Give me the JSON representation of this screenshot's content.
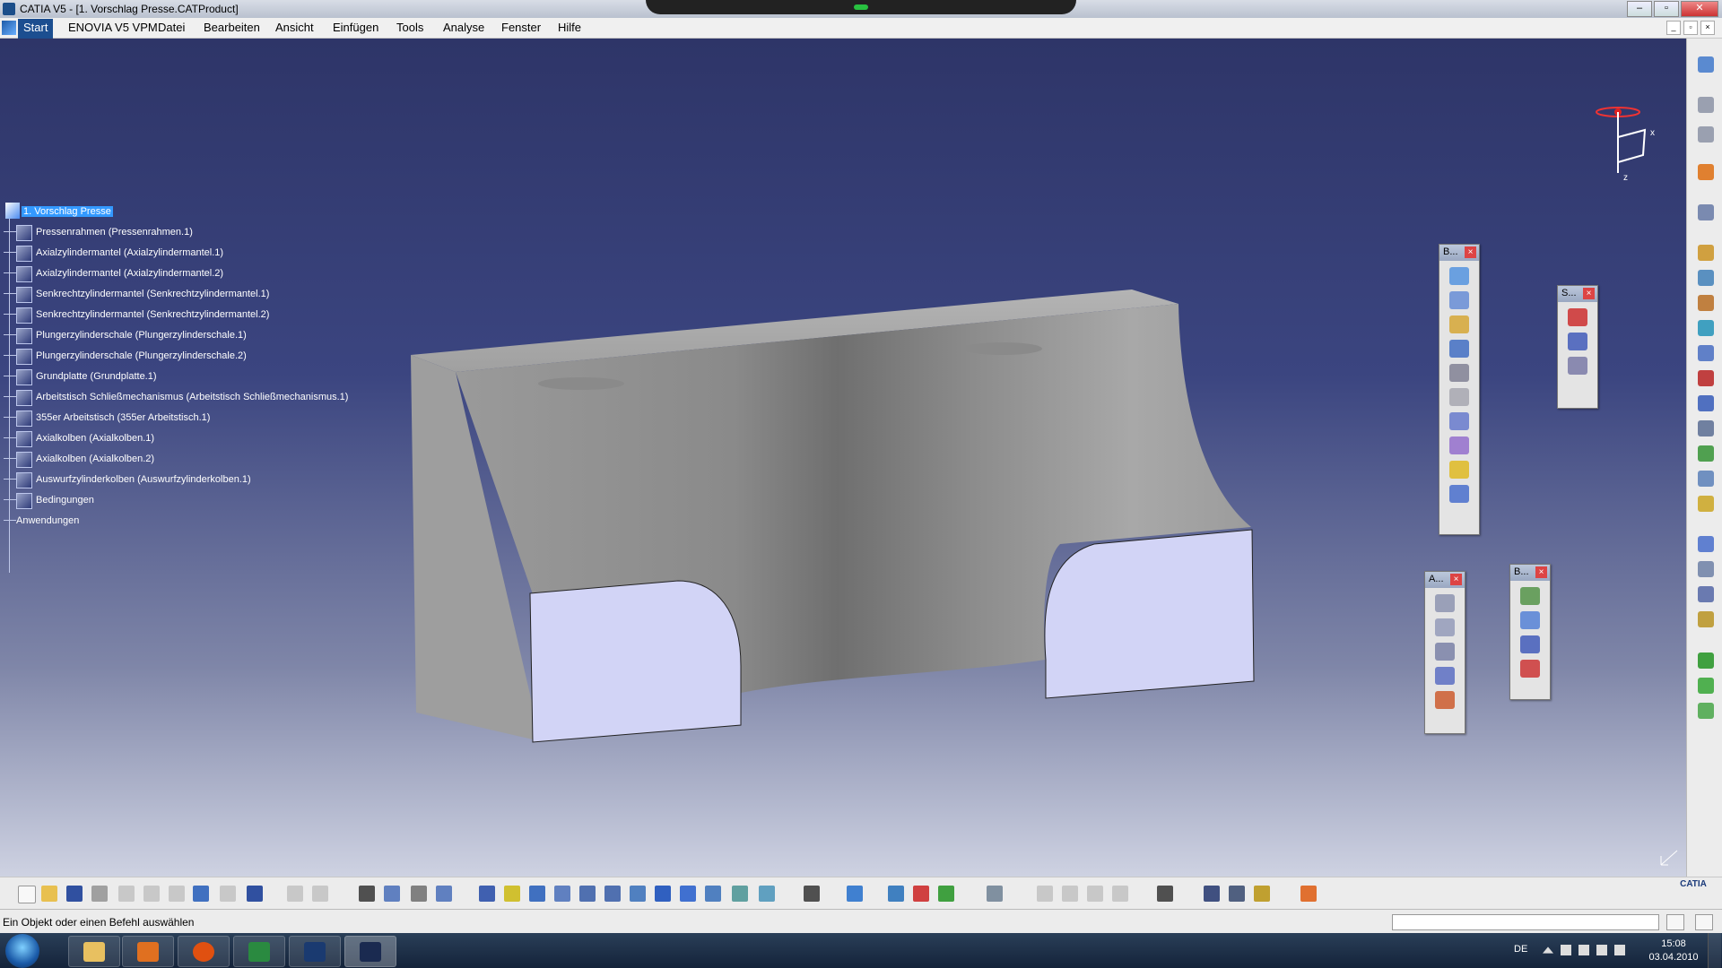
{
  "window": {
    "title": "CATIA V5 - [1. Vorschlag Presse.CATProduct]",
    "controls": [
      "‒",
      "▫",
      "✕"
    ]
  },
  "menu": {
    "start": "Start",
    "items": [
      "ENOVIA V5 VPM",
      "Datei",
      "Bearbeiten",
      "Ansicht",
      "Einfügen",
      "Tools",
      "Analyse",
      "Fenster",
      "Hilfe"
    ]
  },
  "tree": {
    "root": "1. Vorschlag Presse",
    "items": [
      "Pressenrahmen (Pressenrahmen.1)",
      "Axialzylindermantel (Axialzylindermantel.1)",
      "Axialzylindermantel (Axialzylindermantel.2)",
      "Senkrechtzylindermantel (Senkrechtzylindermantel.1)",
      "Senkrechtzylindermantel (Senkrechtzylindermantel.2)",
      "Plungerzylinderschale (Plungerzylinderschale.1)",
      "Plungerzylinderschale (Plungerzylinderschale.2)",
      "Grundplatte (Grundplatte.1)",
      "Arbeitstisch Schließmechanismus (Arbeitstisch Schließmechanismus.1)",
      "355er Arbeitstisch (355er Arbeitstisch.1)",
      "Axialkolben (Axialkolben.1)",
      "Axialkolben (Axialkolben.2)",
      "Auswurfzylinderkolben (Auswurfzylinderkolben.1)",
      "Bedingungen"
    ],
    "applications": "Anwendungen"
  },
  "compass": {
    "x": "x",
    "z": "z"
  },
  "palettes": {
    "p1": {
      "title": "B..."
    },
    "p2": {
      "title": "S..."
    },
    "p3": {
      "title": "A..."
    },
    "p4": {
      "title": "B..."
    }
  },
  "status": {
    "message": "Ein Objekt oder einen Befehl auswählen"
  },
  "brand": {
    "logo": "CATIA"
  },
  "taskbar": {
    "lang": "DE",
    "time": "15:08",
    "date": "03.04.2010"
  }
}
